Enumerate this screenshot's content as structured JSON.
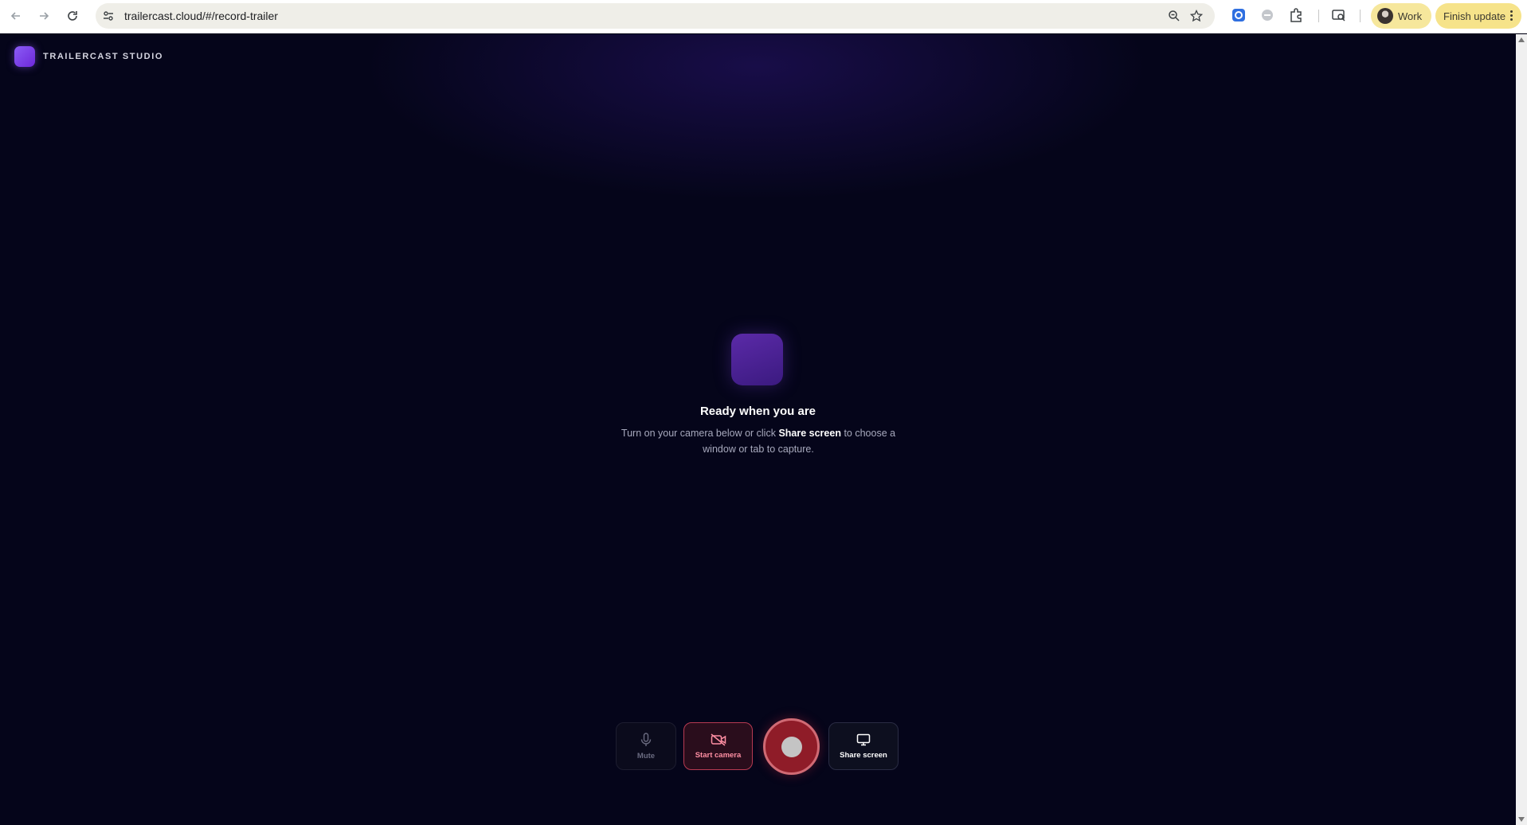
{
  "browser": {
    "url": "trailercast.cloud/#/record-trailer",
    "profile_label": "Work",
    "update_label": "Finish update"
  },
  "app": {
    "brand_name": "TRAILERCAST STUDIO",
    "hero": {
      "title": "Ready when you are",
      "desc_prefix": "Turn on your camera below or click ",
      "desc_bold": "Share screen",
      "desc_suffix": " to choose a window or tab to capture."
    },
    "controls": {
      "mute_label": "Mute",
      "camera_label": "Start camera",
      "share_label": "Share screen"
    }
  },
  "colors": {
    "background": "#05051a",
    "accent": "#8b5cf6",
    "record": "#8f1c28",
    "camera_active": "#ff8fa3"
  }
}
